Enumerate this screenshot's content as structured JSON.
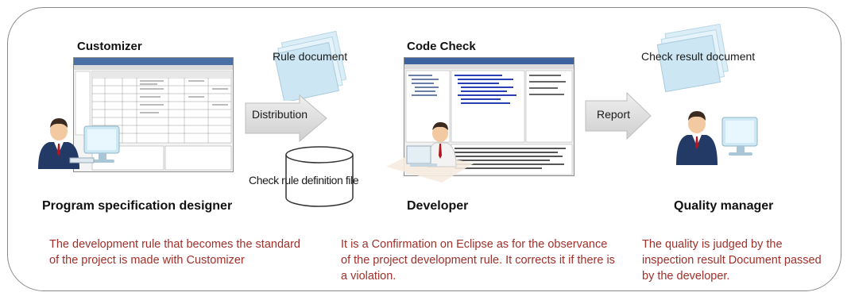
{
  "colors": {
    "description_text": "#a0302a",
    "frame_border": "#8a8a8a",
    "arrow_fill": "#d9d9d9"
  },
  "sections": [
    {
      "tool_title": "Customizer",
      "role": "Program specification designer",
      "description": "The development rule that becomes the standard of the project is made with Customizer"
    },
    {
      "tool_title": "Code Check",
      "role": "Developer",
      "description": "It is a Confirmation on Eclipse as for the observance of the project  development rule. It corrects it if there is a violation."
    },
    {
      "tool_title": "",
      "role": "Quality manager",
      "description": "The quality is judged by the inspection result Document passed by the developer."
    }
  ],
  "artifacts": {
    "rule_document": "Rule document",
    "check_rule_file": "Check rule definition file",
    "check_result_document": "Check result document"
  },
  "arrows": {
    "distribution": "Distribution",
    "report": "Report"
  },
  "icons": [
    "person-at-computer-icon",
    "document-stack-icon",
    "database-cylinder-icon",
    "arrow-right-icon",
    "app-screenshot"
  ]
}
